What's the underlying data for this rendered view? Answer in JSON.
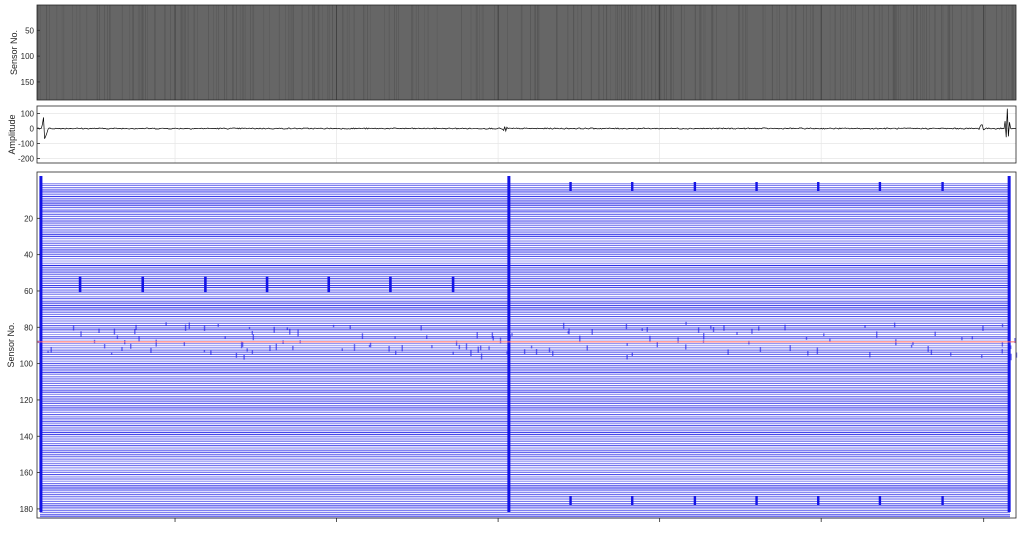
{
  "chart_data": [
    {
      "type": "heatmap",
      "ylabel": "Sensor No.",
      "ylim": [
        1,
        185
      ],
      "yticks": [
        50,
        100,
        150
      ],
      "ytick_labels": [
        "50",
        "100",
        "150"
      ],
      "grid": true,
      "colors": {
        "background": "#666666",
        "trace": "#4a4a4a"
      }
    },
    {
      "type": "line",
      "ylabel": "Amplitude",
      "ylim": [
        -230,
        150
      ],
      "yticks": [
        100,
        0,
        -100,
        -200
      ],
      "ytick_labels": [
        "100",
        "0",
        "-100",
        "-200"
      ],
      "grid": true,
      "series": [
        {
          "color": "#000000",
          "events": [
            {
              "x": 0.008,
              "value": 120
            },
            {
              "x": 0.478,
              "value": -25
            },
            {
              "x": 0.965,
              "value": 30
            },
            {
              "x": 0.991,
              "value": 140
            }
          ]
        }
      ]
    },
    {
      "type": "line",
      "ylabel": "Sensor No.",
      "ylim": [
        185,
        0
      ],
      "yticks": [
        20,
        40,
        60,
        80,
        100,
        120,
        140,
        160,
        180
      ],
      "ytick_labels": [
        "20",
        "40",
        "60",
        "80",
        "100",
        "120",
        "140",
        "160",
        "180"
      ],
      "sensor_count": 185,
      "highlighted_sensor": 88,
      "grid": true,
      "colors": {
        "trace": "#1515e6",
        "highlight": "#ff6666"
      },
      "strong_events_x": [
        0.004,
        0.482,
        0.993
      ],
      "burst_sensor_range": [
        56,
        61
      ],
      "burst_x": [
        0.044,
        0.108,
        0.172,
        0.235,
        0.298,
        0.361,
        0.425
      ],
      "edge_burst_x": [
        0.545,
        0.608,
        0.672,
        0.735,
        0.798,
        0.861,
        0.925
      ]
    }
  ]
}
